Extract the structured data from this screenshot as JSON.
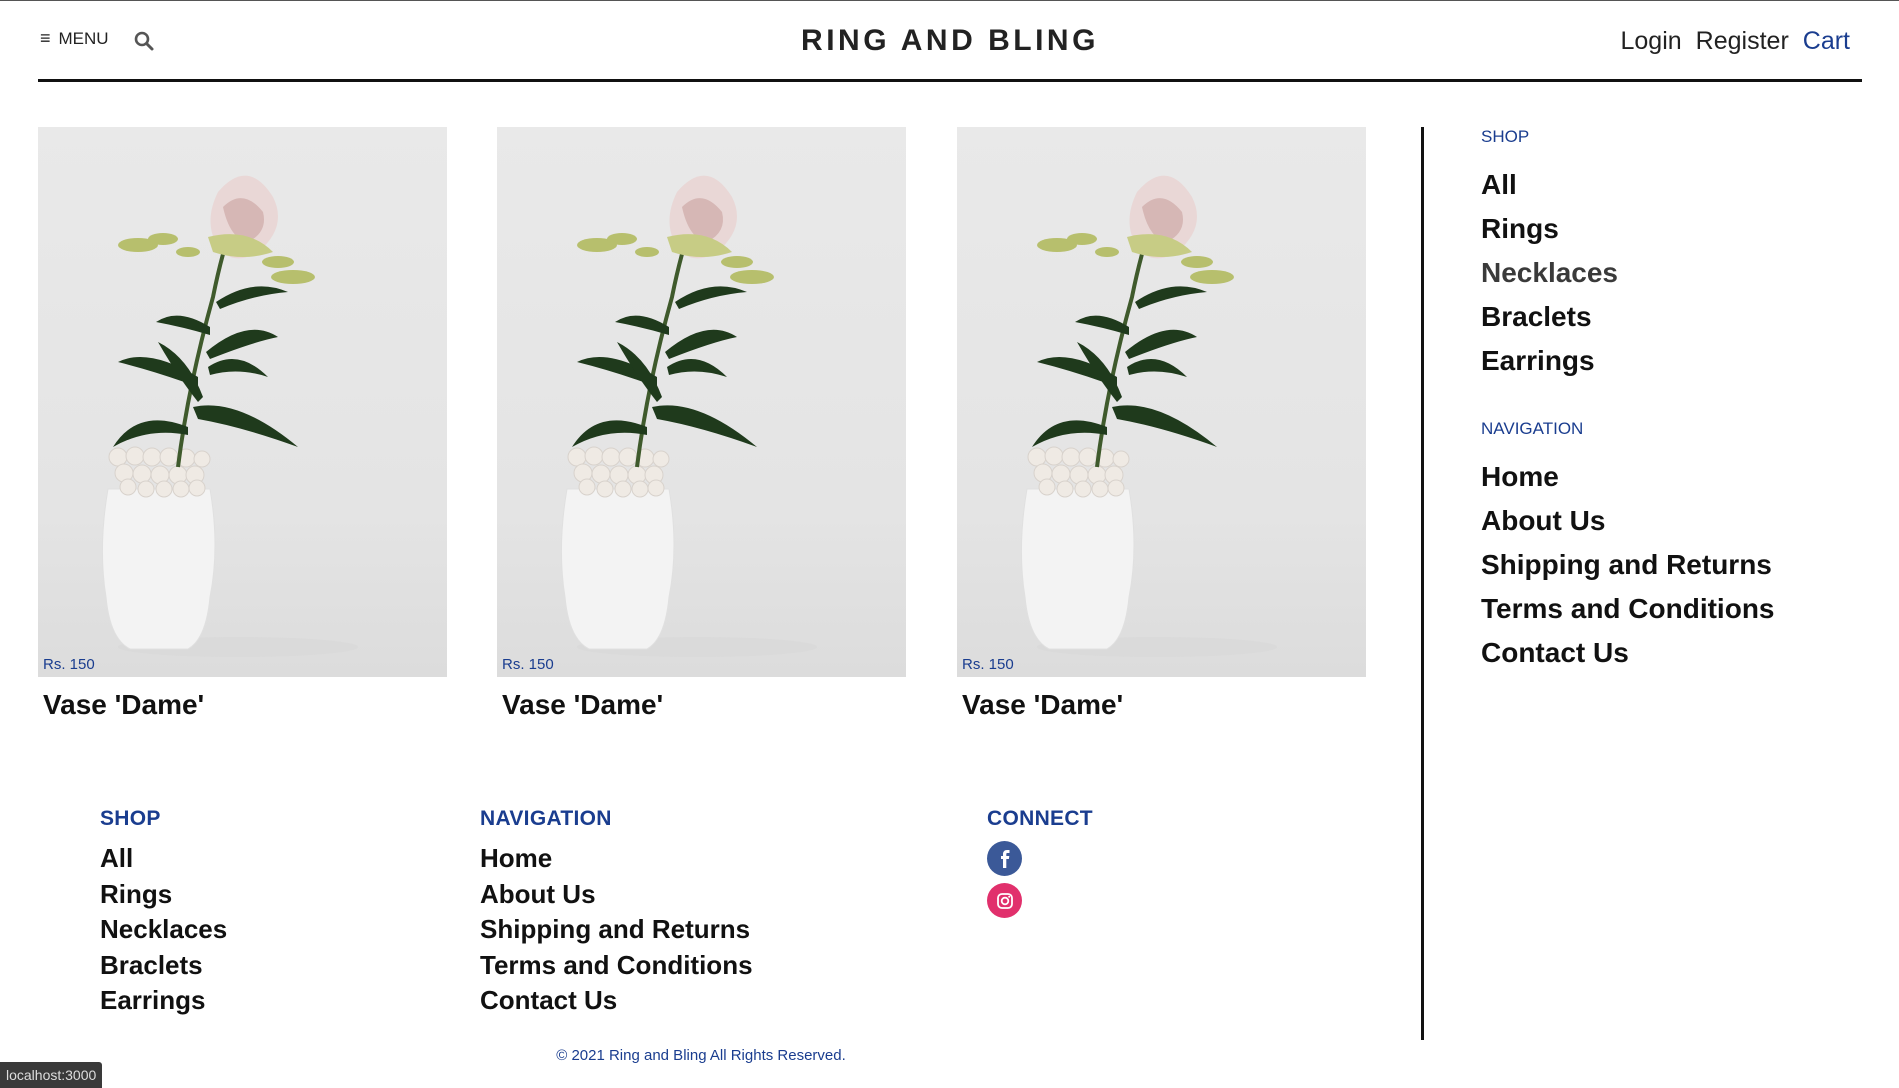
{
  "header": {
    "menu_label": "MENU",
    "brand": "RING AND BLING",
    "links": {
      "login": "Login",
      "register": "Register",
      "cart": "Cart"
    }
  },
  "products": [
    {
      "price": "Rs. 150",
      "title": "Vase 'Dame'"
    },
    {
      "price": "Rs. 150",
      "title": "Vase 'Dame'"
    },
    {
      "price": "Rs. 150",
      "title": "Vase 'Dame'"
    }
  ],
  "side": {
    "shop_heading": "SHOP",
    "shop_items": [
      "All",
      "Rings",
      "Necklaces",
      "Braclets",
      "Earrings"
    ],
    "nav_heading": "NAVIGATION",
    "nav_items": [
      "Home",
      "About Us",
      "Shipping and Returns",
      "Terms and Conditions",
      "Contact Us"
    ]
  },
  "footer": {
    "shop_heading": "SHOP",
    "shop_items": [
      "All",
      "Rings",
      "Necklaces",
      "Braclets",
      "Earrings"
    ],
    "nav_heading": "NAVIGATION",
    "nav_items": [
      "Home",
      "About Us",
      "Shipping and Returns",
      "Terms and Conditions",
      "Contact Us"
    ],
    "connect_heading": "CONNECT",
    "copyright": "© 2021 Ring and Bling All Rights Reserved."
  },
  "status_bar": {
    "url": "localhost:3000"
  },
  "colors": {
    "accent": "#1a3d8f",
    "facebook": "#3b5998",
    "instagram": "#e1306c"
  }
}
